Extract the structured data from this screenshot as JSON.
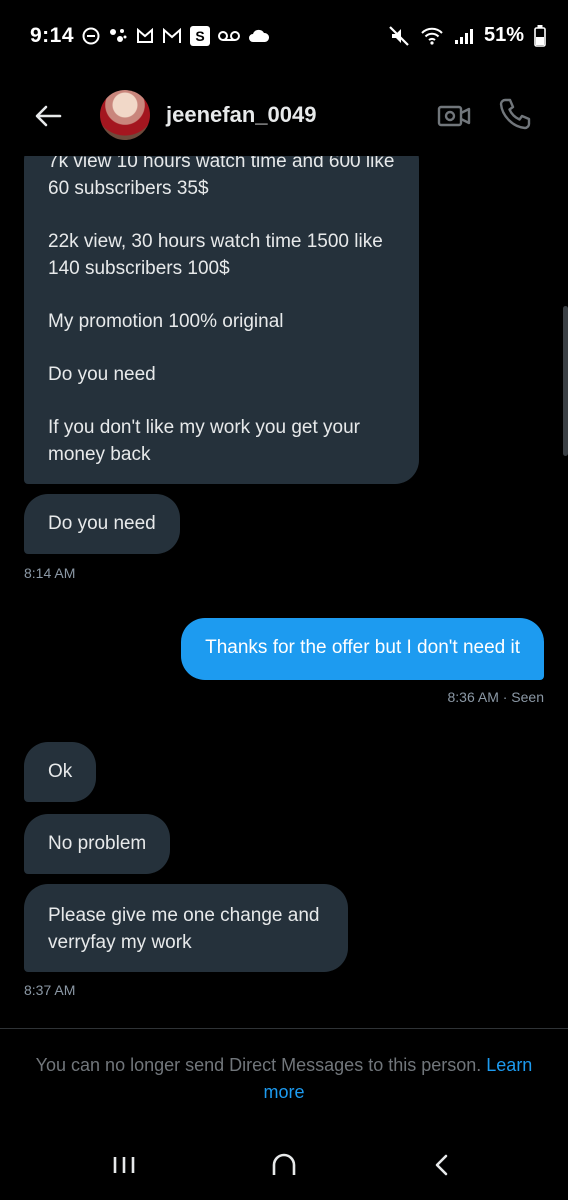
{
  "status_bar": {
    "time": "9:14",
    "battery": "51%",
    "left_icons": [
      "do-not-disturb-icon",
      "assistant-icon",
      "notification-icon",
      "gmail-icon",
      "s-app-icon",
      "voicemail-icon",
      "cloud-icon"
    ],
    "right_icons": [
      "mute-icon",
      "wifi-icon",
      "signal-icon",
      "battery-icon"
    ]
  },
  "header": {
    "username": "jeenefan_0049"
  },
  "messages": {
    "first_paragraphs": [
      "7k view 10 hours watch time and 600 like 60 subscribers 35$",
      "22k view, 30 hours watch time 1500 like 140 subscribers 100$",
      "My promotion 100% original",
      "Do you need",
      "If you don't like my work you get your money back"
    ],
    "second": "Do you need",
    "time1": "8:14 AM",
    "outgoing": "Thanks for the offer but I don't need it",
    "time2": "8:36 AM · Seen",
    "ok": "Ok",
    "no_problem": "No problem",
    "last": "Please give me one change and verryfay my work",
    "time3": "8:37 AM"
  },
  "footer": {
    "notice": "You can no longer send Direct Messages to this person.",
    "learn_more": "Learn more"
  },
  "colors": {
    "background": "#000000",
    "incoming_bubble": "#25313b",
    "outgoing_bubble": "#1d9bf0",
    "link": "#1d9bf0",
    "muted_text": "#71767b"
  }
}
